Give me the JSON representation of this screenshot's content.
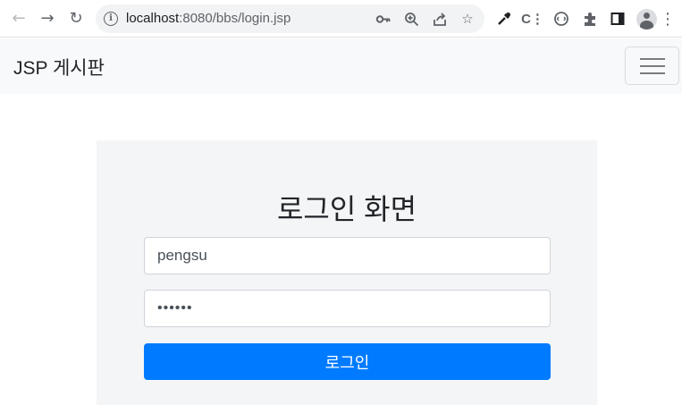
{
  "browser": {
    "url_host": "localhost",
    "url_rest": ":8080/bbs/login.jsp",
    "back_icon": "arrow-left",
    "forward_icon": "arrow-right",
    "reload_icon": "reload"
  },
  "navbar": {
    "brand": "JSP 게시판",
    "toggler_icon": "hamburger-menu"
  },
  "login": {
    "title": "로그인 화면",
    "user_id_value": "pengsu",
    "password_value": "pengsu",
    "submit_label": "로그인"
  },
  "colors": {
    "primary": "#007bff",
    "navbar_bg": "#f8f9fa",
    "panel_bg": "#f4f5f6"
  }
}
